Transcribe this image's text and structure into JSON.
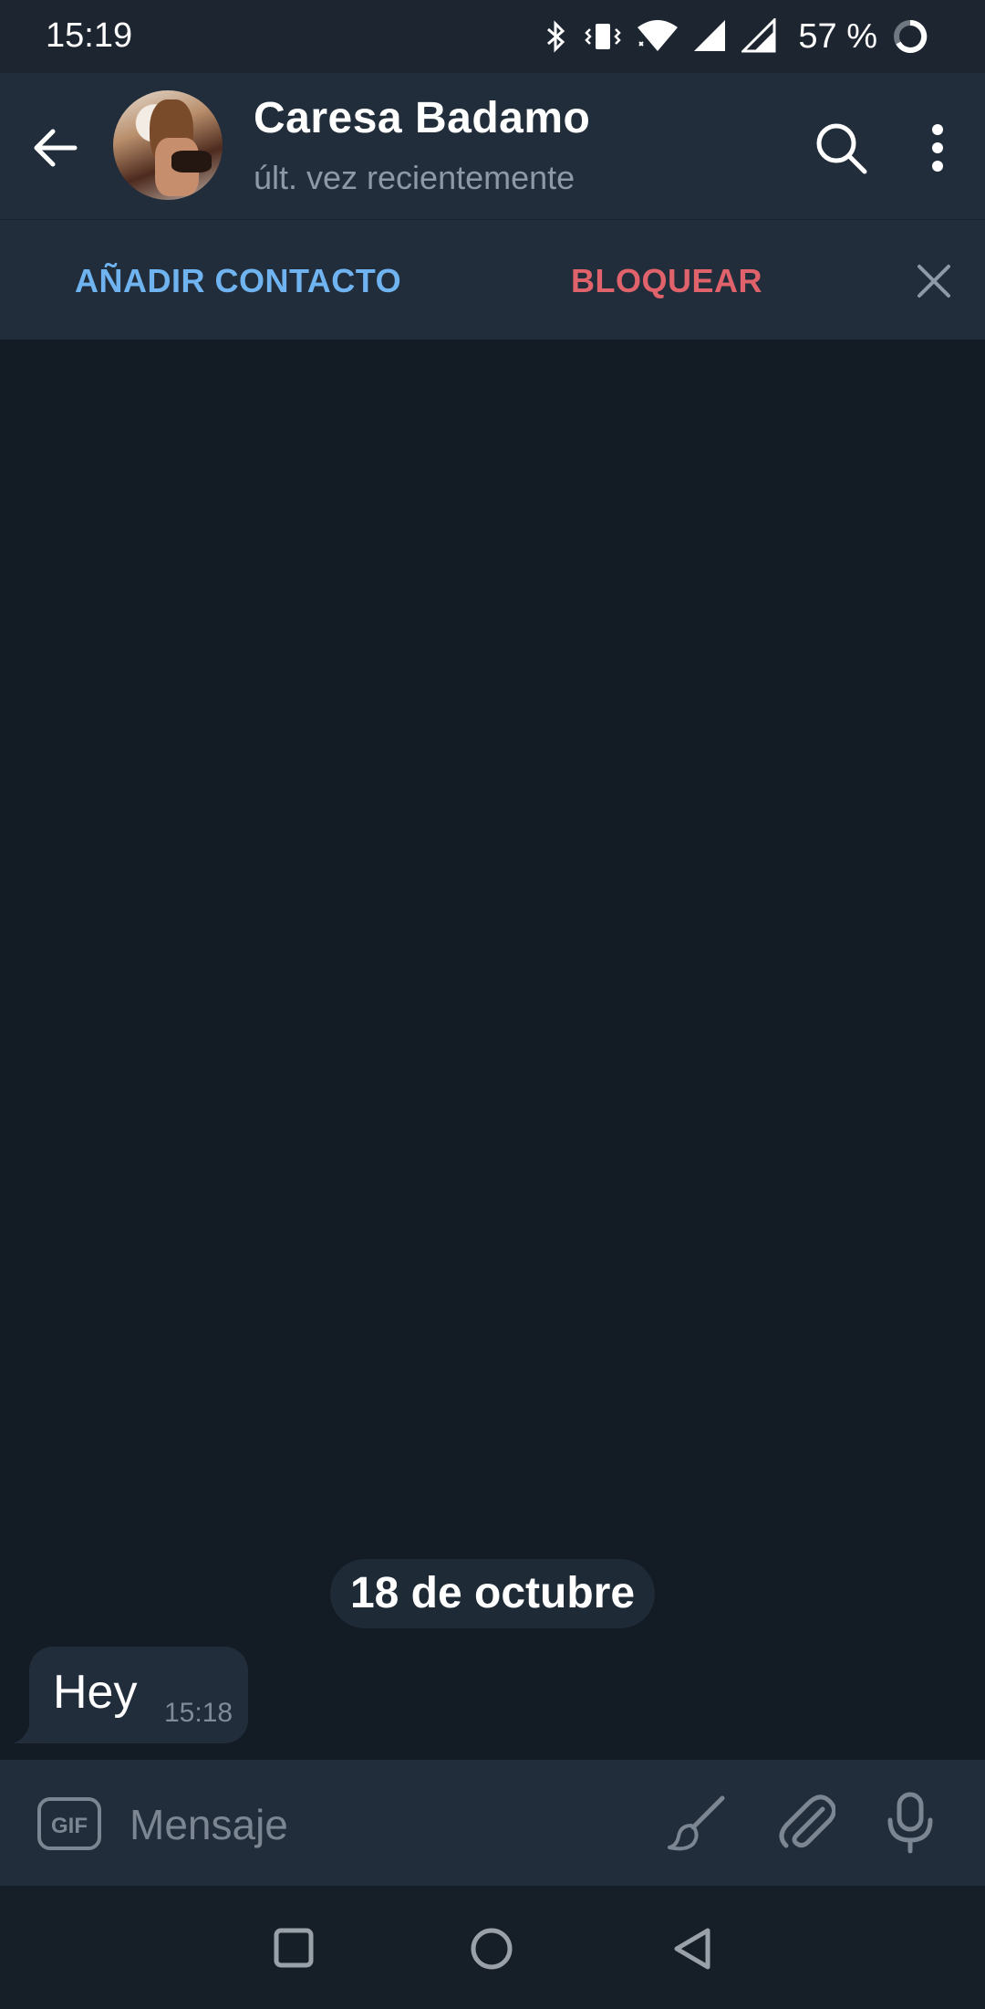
{
  "status_bar": {
    "time": "15:19",
    "battery_percent": "57 %",
    "icons": [
      "bluetooth-icon",
      "vibrate-icon",
      "wifi-icon",
      "signal-icon",
      "signal-icon",
      "battery-ring-icon"
    ]
  },
  "header": {
    "contact_name": "Caresa Badamo",
    "last_seen": "últ. vez recientemente",
    "back_icon": "arrow-left-icon",
    "search_icon": "search-icon",
    "more_icon": "more-vertical-icon"
  },
  "action_bar": {
    "add_contact_label": "AÑADIR CONTACTO",
    "block_label": "BLOQUEAR",
    "close_icon": "close-icon",
    "add_color": "#6fb4f1",
    "block_color": "#e0626a"
  },
  "chat": {
    "date_label": "18 de octubre",
    "messages": [
      {
        "text": "Hey",
        "time": "15:18",
        "incoming": true
      }
    ]
  },
  "composer": {
    "placeholder": "Mensaje",
    "gif_label": "GIF",
    "icons": [
      "gif-icon",
      "brush-icon",
      "paperclip-icon",
      "microphone-icon"
    ]
  },
  "nav_bar": {
    "icons": [
      "recents-square-icon",
      "home-circle-icon",
      "back-triangle-icon"
    ]
  },
  "colors": {
    "background": "#131b24",
    "header": "#222d3b",
    "bubble": "#222d3b"
  }
}
